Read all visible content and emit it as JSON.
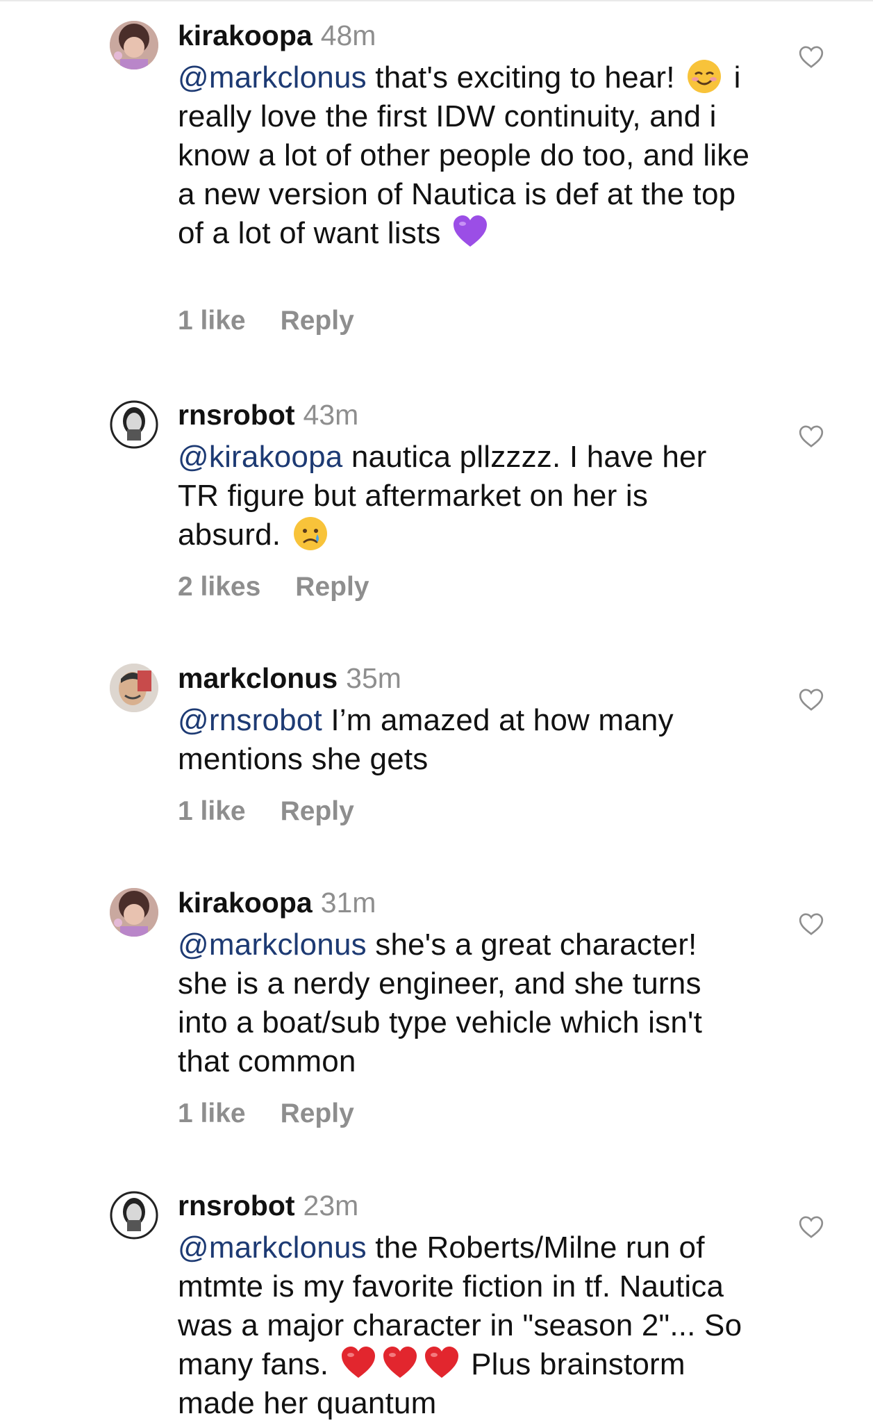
{
  "comments": [
    {
      "username": "kirakoopa",
      "time": "48m",
      "mention": "@markclonus",
      "text1": " that's exciting to hear!",
      "emoji1": "smiling-blush-emoji",
      "text2": " i really love the first IDW continuity, and i know a lot of other people do too, and like a new version of Nautica is def at the top of a lot of want lists",
      "emoji2": "purple-heart-emoji",
      "likes": "1 like",
      "reply": "Reply"
    },
    {
      "username": "rnsrobot",
      "time": "43m",
      "mention": "@kirakoopa",
      "text1": " nautica pllzzzz. I have her TR figure but aftermarket on her is absurd.",
      "emoji1": "crying-face-emoji",
      "likes": "2 likes",
      "reply": "Reply"
    },
    {
      "username": "markclonus",
      "time": "35m",
      "mention": "@rnsrobot",
      "text1": " I’m amazed at how many mentions she gets",
      "likes": "1 like",
      "reply": "Reply"
    },
    {
      "username": "kirakoopa",
      "time": "31m",
      "mention": "@markclonus",
      "text1": " she's a great character! she is a nerdy engineer, and she turns into a boat/sub type vehicle which isn't that common",
      "likes": "1 like",
      "reply": "Reply"
    },
    {
      "username": "rnsrobot",
      "time": "23m",
      "mention": "@markclonus",
      "text1": " the Roberts/Milne run of mtmte is my favorite fiction in tf. Nautica was a major character in \"season 2\"... So many fans.",
      "emoji1": "red-heart-emoji",
      "text2": "Plus brainstorm made her quantum"
    }
  ],
  "colors": {
    "mention": "#1d3a73",
    "muted": "#8e8e8e",
    "text": "#111111"
  }
}
